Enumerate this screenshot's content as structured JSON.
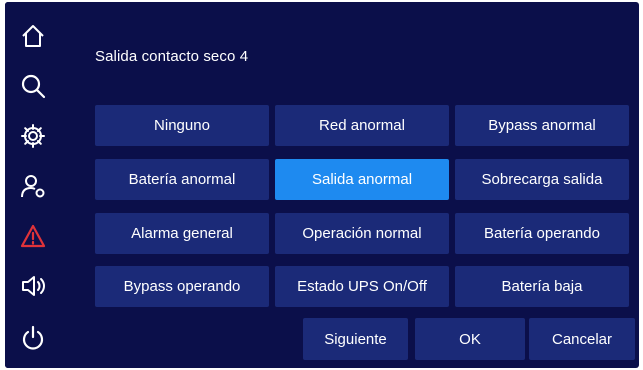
{
  "sidebar": {
    "items": [
      {
        "icon": "home-icon"
      },
      {
        "icon": "search-icon"
      },
      {
        "icon": "gear-icon"
      },
      {
        "icon": "user-settings-icon"
      },
      {
        "icon": "alarm-warning-icon"
      },
      {
        "icon": "speaker-icon"
      },
      {
        "icon": "power-icon"
      }
    ]
  },
  "colors": {
    "background": "#0b0f4a",
    "button": "#1b2a78",
    "selected": "#1e8af0",
    "warning": "#e0333a"
  },
  "title": "Salida contacto seco 4",
  "options": [
    {
      "label": "Ninguno",
      "selected": false
    },
    {
      "label": "Red anormal",
      "selected": false
    },
    {
      "label": "Bypass anormal",
      "selected": false
    },
    {
      "label": "Batería anormal",
      "selected": false
    },
    {
      "label": "Salida anormal",
      "selected": true
    },
    {
      "label": "Sobrecarga salida",
      "selected": false
    },
    {
      "label": "Alarma general",
      "selected": false
    },
    {
      "label": "Operación normal",
      "selected": false
    },
    {
      "label": "Batería operando",
      "selected": false
    },
    {
      "label": "Bypass operando",
      "selected": false
    },
    {
      "label": "Estado UPS On/Off",
      "selected": false
    },
    {
      "label": "Batería baja",
      "selected": false
    }
  ],
  "actions": {
    "next": "Siguiente",
    "ok": "OK",
    "cancel": "Cancelar"
  }
}
